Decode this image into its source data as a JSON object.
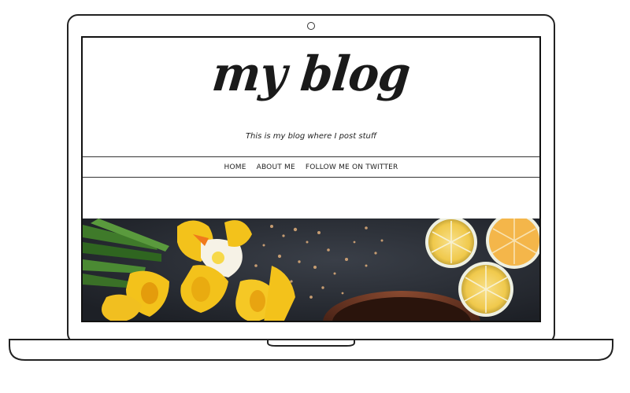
{
  "blog": {
    "logo": "my blog",
    "tagline": "This is my blog where I post stuff"
  },
  "nav": {
    "items": [
      {
        "label": "HOME"
      },
      {
        "label": "ABOUT ME"
      },
      {
        "label": "FOLLOW ME ON TWITTER"
      }
    ]
  },
  "hero": {
    "image": "flowers-and-lemons-photo",
    "icons": [
      "daffodil-bouquet",
      "lemon-slice",
      "coffee-cup",
      "nut-crumbs"
    ]
  },
  "colors": {
    "outline": "#222222",
    "text": "#1a1a1a",
    "hero_background": "#2a2d34",
    "daffodil_yellow": "#f3c21b",
    "lemon_yellow": "#f6d36a",
    "stem_green": "#3f7a2a"
  }
}
